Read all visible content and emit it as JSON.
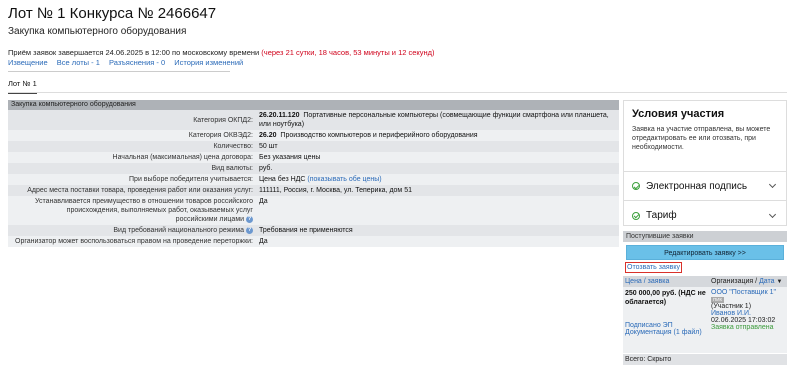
{
  "header": {
    "title": "Лот № 1 Конкурса № 2466647",
    "subtitle": "Закупка компьютерного оборудования",
    "deadline_text": "Приём заявок завершается 24.06.2025 в 12:00 по московскому времени",
    "countdown": "(через 21 сутки, 18 часов, 53 минуты и 12 секунд)"
  },
  "nav": {
    "notice": "Извещение",
    "all_lots": "Все лоты - 1",
    "clarifications": "Разъяснения - 0",
    "history": "История изменений"
  },
  "tab": {
    "lot": "Лот № 1"
  },
  "info": {
    "heading": "Закупка компьютерного оборудования",
    "rows": [
      {
        "label": "Категория ОКПД2:",
        "code": "26.20.11.120",
        "value": "Портативные персональные компьютеры (совмещающие функции смартфона или планшета, или ноутбука)"
      },
      {
        "label": "Категория ОКВЭД2:",
        "code": "26.20",
        "value": "Производство компьютеров и периферийного оборудования"
      },
      {
        "label": "Количество:",
        "code": "",
        "value": "50 шт"
      },
      {
        "label": "Начальная (максимальная) цена договора:",
        "code": "",
        "value": "Без указания цены"
      },
      {
        "label": "Вид валюты:",
        "code": "",
        "value": "руб."
      },
      {
        "label": "При выборе победителя учитывается:",
        "code": "",
        "value": "Цена без НДС",
        "link": "(показывать обе цены)"
      },
      {
        "label": "Адрес места поставки товара, проведения работ или оказания услуг:",
        "code": "",
        "value": "111111, Россия, г. Москва, ул. Теперика, дом 51"
      },
      {
        "label": "Устанавливается преимущество в отношении товаров российского происхождения, выполняемых работ, оказываемых услуг российскими лицами",
        "code": "",
        "value": "Да"
      },
      {
        "label": "Вид требований национального режима",
        "code": "",
        "value": "Требования не применяются"
      },
      {
        "label": "Организатор может воспользоваться правом на проведение переторжки:",
        "code": "",
        "value": "Да"
      }
    ]
  },
  "conditions": {
    "title": "Условия участия",
    "description": "Заявка на участие отправлена, вы можете отредактировать ее или отозвать, при необходимости.",
    "items": [
      "Электронная подпись",
      "Тариф"
    ]
  },
  "bids": {
    "heading": "Поступившие заявки",
    "edit_button": "Редактировать заявку >>",
    "withdraw_link": "Отозвать заявку",
    "col_price": "Цена / заявка",
    "col_org": "Организация /",
    "col_date": "Дата",
    "sort_icon": "▼",
    "price": "250 000,00 руб. (НДС не облагается)",
    "signed": "Подписано ЭП",
    "docs": "Документация (1 файл)",
    "org": "ООО \"Поставщик 1\"",
    "org_tag": "ПИК",
    "participant": "(Участник 1)",
    "person": "Иванов И.И.",
    "date": "02.06.2025 17:03:02",
    "status": "Заявка отправлена",
    "total": "Всего: Скрыто"
  }
}
